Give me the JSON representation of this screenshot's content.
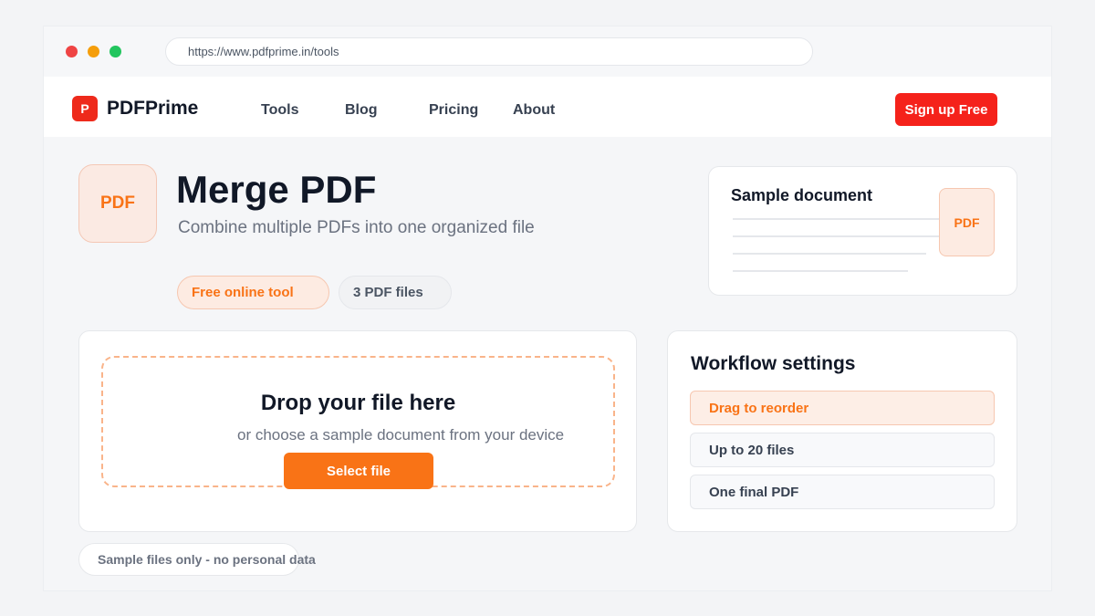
{
  "browser": {
    "url": "https://www.pdfprime.in/tools",
    "controls": [
      "close",
      "minimize",
      "maximize"
    ]
  },
  "nav": {
    "logo_mark": "P",
    "logo_text": "PDFPrime",
    "links": [
      "Tools",
      "Blog",
      "Pricing",
      "About"
    ],
    "signup_label": "Sign up Free"
  },
  "hero": {
    "icon_label": "PDF",
    "title": "Merge PDF",
    "subtitle": "Combine multiple PDFs into one organized file",
    "chips": [
      "Free online tool",
      "3 PDF files"
    ]
  },
  "sample": {
    "title": "Sample document",
    "badge": "PDF"
  },
  "upload": {
    "title": "Drop your file here",
    "subtitle": "or choose a sample document from your device",
    "button_label": "Select file"
  },
  "workflow": {
    "title": "Workflow settings",
    "options": [
      "Drag to reorder",
      "Up to 20 files",
      "One final PDF"
    ],
    "selected_index": 0
  },
  "footer_note": "Sample files only - no personal data",
  "colors": {
    "brand_red": "#ee2a1b",
    "accent_orange": "#f97316",
    "signup_red": "#f5221b"
  }
}
